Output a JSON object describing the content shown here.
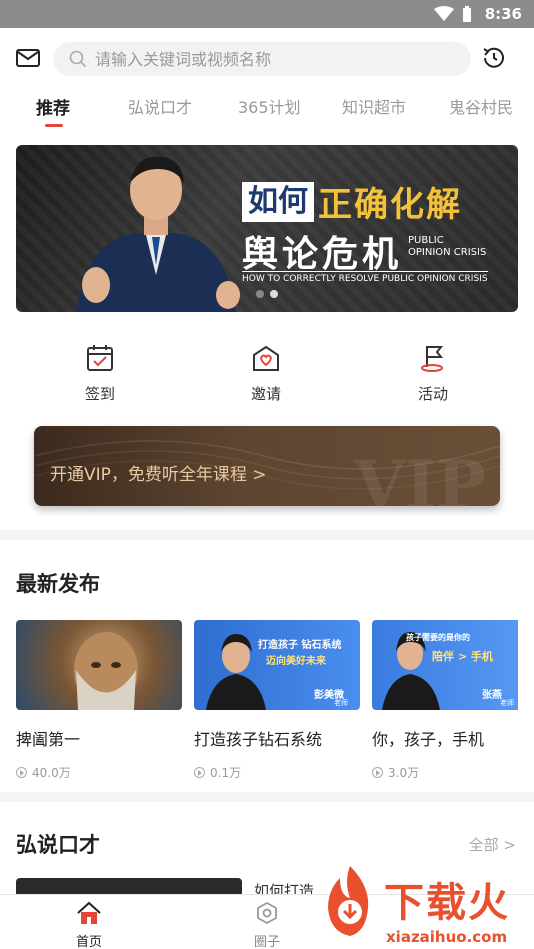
{
  "status": {
    "time": "8:36"
  },
  "search": {
    "placeholder": "请输入关键词或视频名称"
  },
  "tabs": [
    {
      "label": "推荐",
      "active": true
    },
    {
      "label": "弘说口才",
      "active": false
    },
    {
      "label": "365计划",
      "active": false
    },
    {
      "label": "知识超市",
      "active": false
    },
    {
      "label": "鬼谷村民",
      "active": false
    }
  ],
  "banner": {
    "highlight": "如何",
    "title_yellow": "正确化解",
    "title_white": "舆论危机",
    "side_line1": "PUBLIC",
    "side_line2": "OPINION CRISIS",
    "subtitle": "HOW TO CORRECTLY RESOLVE PUBLIC OPINION CRISIS",
    "page_count": 2,
    "current_page": 2
  },
  "quick_actions": [
    {
      "label": "签到",
      "icon": "calendar-check-icon"
    },
    {
      "label": "邀请",
      "icon": "invite-heart-icon"
    },
    {
      "label": "活动",
      "icon": "flag-icon"
    }
  ],
  "vip": {
    "text": "开通VIP，免费听全年课程 >",
    "watermark": "VIP"
  },
  "latest": {
    "title": "最新发布",
    "items": [
      {
        "title": "捭阖第一",
        "views": "40.0万"
      },
      {
        "title": "打造孩子钻石系统",
        "views": "0.1万",
        "thumb_line1": "打造孩子 钻石系统",
        "thumb_line2": "迈向美好未来",
        "thumb_name": "彭美微",
        "thumb_role": "老师"
      },
      {
        "title": "你，孩子，手机",
        "views": "3.0万",
        "thumb_line1": "孩子需要的是你的",
        "thumb_line2": "陪伴 > 手机",
        "thumb_name": "张燕",
        "thumb_role": "老师"
      }
    ]
  },
  "hongshuo": {
    "title": "弘说口才",
    "more": "全部 >",
    "first_item_title": "如何打造"
  },
  "bottom_nav": [
    {
      "label": "首页",
      "active": true
    },
    {
      "label": "圈子",
      "active": false
    }
  ],
  "watermark": {
    "text": "下载火",
    "url": "xiazaihuo.com"
  },
  "colors": {
    "accent": "#e0463a",
    "vip_text": "#e8c9a3",
    "banner_yellow": "#f2c23a"
  }
}
